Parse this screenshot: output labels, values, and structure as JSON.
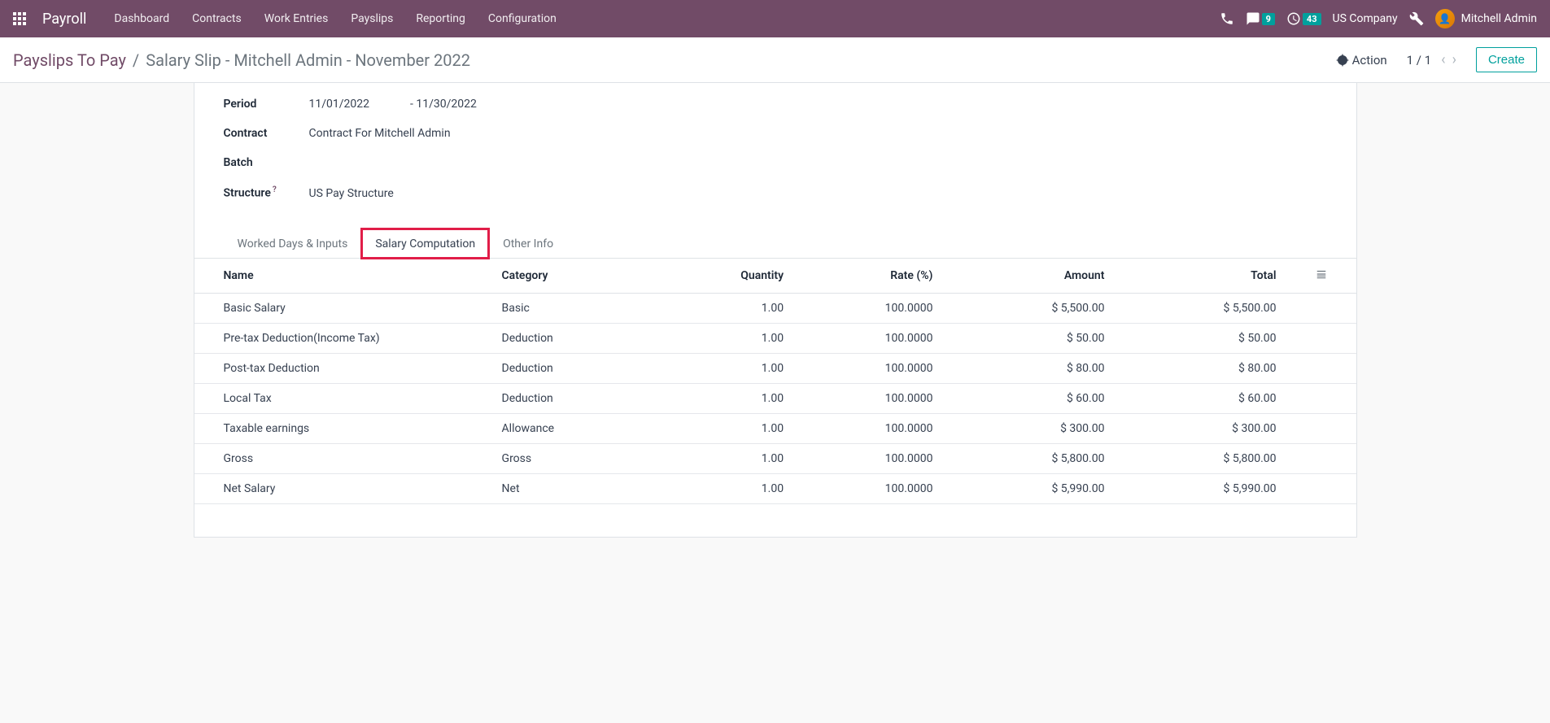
{
  "navbar": {
    "brand": "Payroll",
    "menu": [
      "Dashboard",
      "Contracts",
      "Work Entries",
      "Payslips",
      "Reporting",
      "Configuration"
    ],
    "messages_count": "9",
    "activities_count": "43",
    "company": "US Company",
    "user": "Mitchell Admin"
  },
  "control": {
    "breadcrumb_link": "Payslips To Pay",
    "breadcrumb_current": "Salary Slip - Mitchell Admin - November 2022",
    "action_label": "Action",
    "pager": "1 / 1",
    "create_label": "Create"
  },
  "fields": {
    "period_label": "Period",
    "period_from": "11/01/2022",
    "period_to": "- 11/30/2022",
    "contract_label": "Contract",
    "contract_value": "Contract For Mitchell Admin",
    "batch_label": "Batch",
    "batch_value": "",
    "structure_label": "Structure",
    "structure_value": "US Pay Structure"
  },
  "tabs": {
    "worked_days": "Worked Days & Inputs",
    "salary_comp": "Salary Computation",
    "other_info": "Other Info"
  },
  "table": {
    "headers": {
      "name": "Name",
      "category": "Category",
      "quantity": "Quantity",
      "rate": "Rate (%)",
      "amount": "Amount",
      "total": "Total"
    },
    "rows": [
      {
        "name": "Basic Salary",
        "category": "Basic",
        "quantity": "1.00",
        "rate": "100.0000",
        "amount": "$ 5,500.00",
        "total": "$ 5,500.00"
      },
      {
        "name": "Pre-tax Deduction(Income Tax)",
        "category": "Deduction",
        "quantity": "1.00",
        "rate": "100.0000",
        "amount": "$ 50.00",
        "total": "$ 50.00"
      },
      {
        "name": "Post-tax Deduction",
        "category": "Deduction",
        "quantity": "1.00",
        "rate": "100.0000",
        "amount": "$ 80.00",
        "total": "$ 80.00"
      },
      {
        "name": "Local Tax",
        "category": "Deduction",
        "quantity": "1.00",
        "rate": "100.0000",
        "amount": "$ 60.00",
        "total": "$ 60.00"
      },
      {
        "name": "Taxable earnings",
        "category": "Allowance",
        "quantity": "1.00",
        "rate": "100.0000",
        "amount": "$ 300.00",
        "total": "$ 300.00"
      },
      {
        "name": "Gross",
        "category": "Gross",
        "quantity": "1.00",
        "rate": "100.0000",
        "amount": "$ 5,800.00",
        "total": "$ 5,800.00"
      },
      {
        "name": "Net Salary",
        "category": "Net",
        "quantity": "1.00",
        "rate": "100.0000",
        "amount": "$ 5,990.00",
        "total": "$ 5,990.00"
      }
    ]
  }
}
